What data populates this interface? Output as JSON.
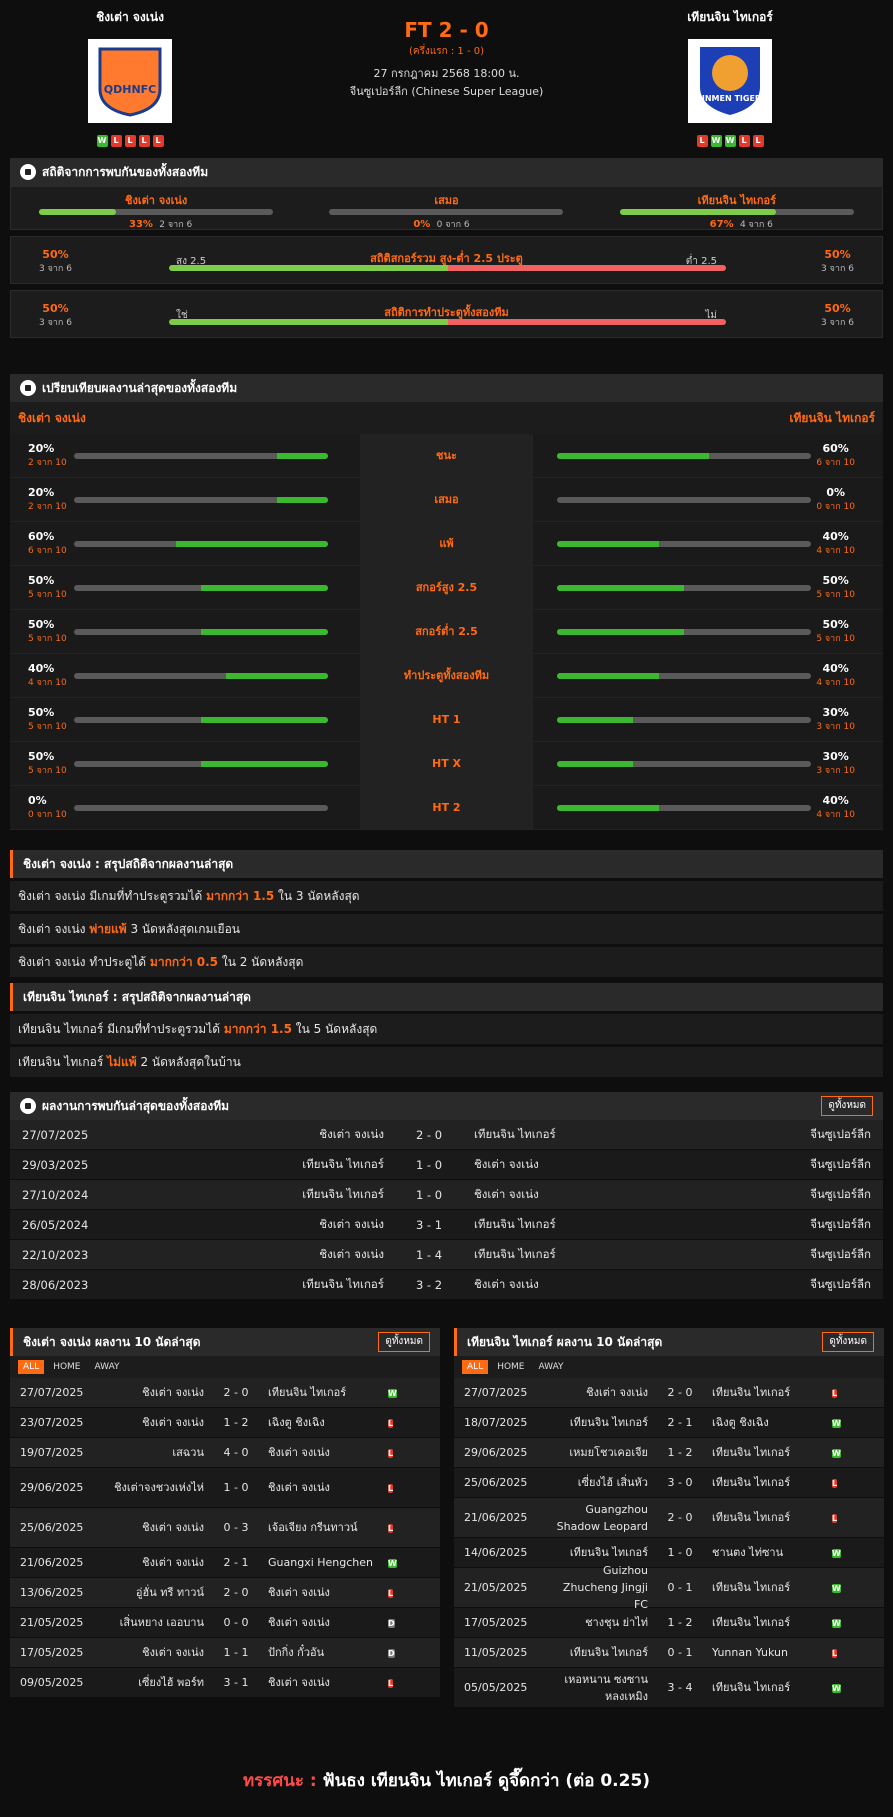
{
  "match": {
    "home": "ชิงเต่า จงเน่ง",
    "away": "เทียนจิน ไทเกอร์",
    "score": "FT 2 - 0",
    "ht": "(ครึ่งแรก : 1 - 0)",
    "date": "27 กรกฎาคม 2568 18:00 น.",
    "league": "จีนซูเปอร์ลีก (Chinese Super League)",
    "home_form": [
      "W",
      "L",
      "L",
      "L",
      "L"
    ],
    "away_form": [
      "L",
      "W",
      "W",
      "L",
      "L"
    ],
    "home_logo": "QDHNFC",
    "away_logo": "JINMEN TIGER"
  },
  "h2h_stats": {
    "title": "สถิติจากการพบกันของทั้งสองทีม",
    "home_label": "ชิงเต่า จงเน่ง",
    "draw_label": "เสมอ",
    "away_label": "เทียนจิน ไทเกอร์",
    "home_pct": "33%",
    "home_sub": "2 จาก 6",
    "draw_pct": "0%",
    "draw_sub": "0 จาก 6",
    "away_pct": "67%",
    "away_sub": "4 จาก 6",
    "home_val": 0.33,
    "draw_val": 0,
    "away_val": 0.67
  },
  "ou": {
    "title": "สถิติสกอร์รวม สูง-ต่ำ 2.5 ประตู",
    "left_label": "สูง 2.5",
    "right_label": "ต่ำ 2.5",
    "left_pct": "50%",
    "left_sub": "3 จาก 6",
    "right_pct": "50%",
    "right_sub": "3 จาก 6",
    "val": 0.5
  },
  "btts": {
    "title": "สถิติการทำประตูทั้งสองทีม",
    "left_label": "ใช่",
    "right_label": "ไม่",
    "left_pct": "50%",
    "left_sub": "3 จาก 6",
    "right_pct": "50%",
    "right_sub": "3 จาก 6",
    "val": 0.5
  },
  "compare": {
    "title": "เปรียบเทียบผลงานล่าสุดของทั้งสองทีม",
    "home": "ชิงเต่า จงเน่ง",
    "away": "เทียนจิน ไทเกอร์",
    "rows": [
      {
        "label": "ชนะ",
        "hp": "20%",
        "hs": "2 จาก 10",
        "hv": 0.2,
        "ap": "60%",
        "as": "6 จาก 10",
        "av": 0.6
      },
      {
        "label": "เสมอ",
        "hp": "20%",
        "hs": "2 จาก 10",
        "hv": 0.2,
        "ap": "0%",
        "as": "0 จาก 10",
        "av": 0
      },
      {
        "label": "แพ้",
        "hp": "60%",
        "hs": "6 จาก 10",
        "hv": 0.6,
        "ap": "40%",
        "as": "4 จาก 10",
        "av": 0.4
      },
      {
        "label": "สกอร์สูง 2.5",
        "hp": "50%",
        "hs": "5 จาก 10",
        "hv": 0.5,
        "ap": "50%",
        "as": "5 จาก 10",
        "av": 0.5
      },
      {
        "label": "สกอร์ต่ำ 2.5",
        "hp": "50%",
        "hs": "5 จาก 10",
        "hv": 0.5,
        "ap": "50%",
        "as": "5 จาก 10",
        "av": 0.5
      },
      {
        "label": "ทำประตูทั้งสองทีม",
        "hp": "40%",
        "hs": "4 จาก 10",
        "hv": 0.4,
        "ap": "40%",
        "as": "4 จาก 10",
        "av": 0.4
      },
      {
        "label": "HT 1",
        "hp": "50%",
        "hs": "5 จาก 10",
        "hv": 0.5,
        "ap": "30%",
        "as": "3 จาก 10",
        "av": 0.3
      },
      {
        "label": "HT X",
        "hp": "50%",
        "hs": "5 จาก 10",
        "hv": 0.5,
        "ap": "30%",
        "as": "3 จาก 10",
        "av": 0.3
      },
      {
        "label": "HT 2",
        "hp": "0%",
        "hs": "0 จาก 10",
        "hv": 0,
        "ap": "40%",
        "as": "4 จาก 10",
        "av": 0.4
      }
    ]
  },
  "summary_home": {
    "title": "ชิงเต่า จงเน่ง : สรุปสถิติจากผลงานล่าสุด",
    "rows": [
      [
        "ชิงเต่า จงเน่ง  มีเกมที่ทำประตูรวมได้ ",
        "มากกว่า  1.5",
        " ใน 3 นัดหลังสุด"
      ],
      [
        "ชิงเต่า จงเน่ง  ",
        "พ่ายแพ้",
        " 3  นัดหลังสุดเกมเยือน"
      ],
      [
        "ชิงเต่า จงเน่ง  ทำประตูได้ ",
        "มากกว่า  0.5",
        " ใน 2 นัดหลังสุด"
      ]
    ]
  },
  "summary_away": {
    "title": "เทียนจิน ไทเกอร์ : สรุปสถิติจากผลงานล่าสุด",
    "rows": [
      [
        "เทียนจิน ไทเกอร์  มีเกมที่ทำประตูรวมได้ ",
        "มากกว่า  1.5",
        " ใน 5 นัดหลังสุด"
      ],
      [
        "เทียนจิน ไทเกอร์  ",
        "ไม่แพ้",
        " 2  นัดหลังสุดในบ้าน"
      ]
    ]
  },
  "h2h": {
    "title": "ผลงานการพบกันล่าสุดของทั้งสองทีม",
    "button": "ดูทั้งหมด",
    "rows": [
      [
        "27/07/2025",
        "ชิงเต่า จงเน่ง",
        "2 - 0",
        "เทียนจิน ไทเกอร์",
        "จีนซูเปอร์ลีก"
      ],
      [
        "29/03/2025",
        "เทียนจิน ไทเกอร์",
        "1 - 0",
        "ชิงเต่า จงเน่ง",
        "จีนซูเปอร์ลีก"
      ],
      [
        "27/10/2024",
        "เทียนจิน ไทเกอร์",
        "1 - 0",
        "ชิงเต่า จงเน่ง",
        "จีนซูเปอร์ลีก"
      ],
      [
        "26/05/2024",
        "ชิงเต่า จงเน่ง",
        "3 - 1",
        "เทียนจิน ไทเกอร์",
        "จีนซูเปอร์ลีก"
      ],
      [
        "22/10/2023",
        "ชิงเต่า จงเน่ง",
        "1 - 4",
        "เทียนจิน ไทเกอร์",
        "จีนซูเปอร์ลีก"
      ],
      [
        "28/06/2023",
        "เทียนจิน ไทเกอร์",
        "3 - 2",
        "ชิงเต่า จงเน่ง",
        "จีนซูเปอร์ลีก"
      ]
    ]
  },
  "form_home": {
    "title": "ชิงเต่า จงเน่ง ผลงาน 10 นัดล่าสุด",
    "button": "ดูทั้งหมด",
    "filters": [
      "ALL",
      "HOME",
      "AWAY"
    ],
    "rows": [
      [
        "27/07/2025",
        "ชิงเต่า จงเน่ง",
        "2 - 0",
        "เทียนจิน ไทเกอร์",
        "W"
      ],
      [
        "23/07/2025",
        "ชิงเต่า จงเน่ง",
        "1 - 2",
        "เฉิงตู ชิงเฉิง",
        "L"
      ],
      [
        "19/07/2025",
        "เสฉวน",
        "4 - 0",
        "ชิงเต่า จงเน่ง",
        "L"
      ],
      [
        "29/06/2025",
        "ชิงเต่าจงชวงเห่งไห่",
        "1 - 0",
        "ชิงเต่า จงเน่ง",
        "L"
      ],
      [
        "25/06/2025",
        "ชิงเต่า จงเน่ง",
        "0 - 3",
        "เจ้อเจียง กรีนทาวน์",
        "L"
      ],
      [
        "21/06/2025",
        "ชิงเต่า จงเน่ง",
        "2 - 1",
        "Guangxi Hengchen",
        "W"
      ],
      [
        "13/06/2025",
        "อู่ฮั่น ทรี ทาวน์",
        "2 - 0",
        "ชิงเต่า จงเน่ง",
        "L"
      ],
      [
        "21/05/2025",
        "เสิ่นหยาง เออบาน",
        "0 - 0",
        "ชิงเต่า จงเน่ง",
        "D"
      ],
      [
        "17/05/2025",
        "ชิงเต่า จงเน่ง",
        "1 - 1",
        "ปักกิ่ง กั๋วอัน",
        "D"
      ],
      [
        "09/05/2025",
        "เซี่ยงไฮ้ พอร์ท",
        "3 - 1",
        "ชิงเต่า จงเน่ง",
        "L"
      ]
    ]
  },
  "form_away": {
    "title": "เทียนจิน ไทเกอร์ ผลงาน 10 นัดล่าสุด",
    "button": "ดูทั้งหมด",
    "filters": [
      "ALL",
      "HOME",
      "AWAY"
    ],
    "rows": [
      [
        "27/07/2025",
        "ชิงเต่า จงเน่ง",
        "2 - 0",
        "เทียนจิน ไทเกอร์",
        "L"
      ],
      [
        "18/07/2025",
        "เทียนจิน ไทเกอร์",
        "2 - 1",
        "เฉิงตู ชิงเฉิง",
        "W"
      ],
      [
        "29/06/2025",
        "เหมยโชวเคอเจีย",
        "1 - 2",
        "เทียนจิน ไทเกอร์",
        "W"
      ],
      [
        "25/06/2025",
        "เซี่ยงไฮ้ เสิ่นหัว",
        "3 - 0",
        "เทียนจิน ไทเกอร์",
        "L"
      ],
      [
        "21/06/2025",
        "Guangzhou Shadow Leopard",
        "2 - 0",
        "เทียนจิน ไทเกอร์",
        "L"
      ],
      [
        "14/06/2025",
        "เทียนจิน ไทเกอร์",
        "1 - 0",
        "ชานตง ไท่ซาน",
        "W"
      ],
      [
        "21/05/2025",
        "Guizhou Zhucheng Jingji FC",
        "0 - 1",
        "เทียนจิน ไทเกอร์",
        "W"
      ],
      [
        "17/05/2025",
        "ชางชุน ย่าไท่",
        "1 - 2",
        "เทียนจิน ไทเกอร์",
        "W"
      ],
      [
        "11/05/2025",
        "เทียนจิน ไทเกอร์",
        "0 - 1",
        "Yunnan Yukun",
        "L"
      ],
      [
        "05/05/2025",
        "เหอหนาน ซงซาน หลงเหมิง",
        "3 - 4",
        "เทียนจิน ไทเกอร์",
        "W"
      ]
    ]
  },
  "footer": {
    "label": "ทรรศนะ :",
    "text": "  ฟันธง เทียนจิน ไทเกอร์ ดูจึ๊ดกว่า (ต่อ 0.25)"
  },
  "colors": {
    "accent": "#ff6a13",
    "green": "#3bb82f",
    "red": "#e23a2a"
  }
}
